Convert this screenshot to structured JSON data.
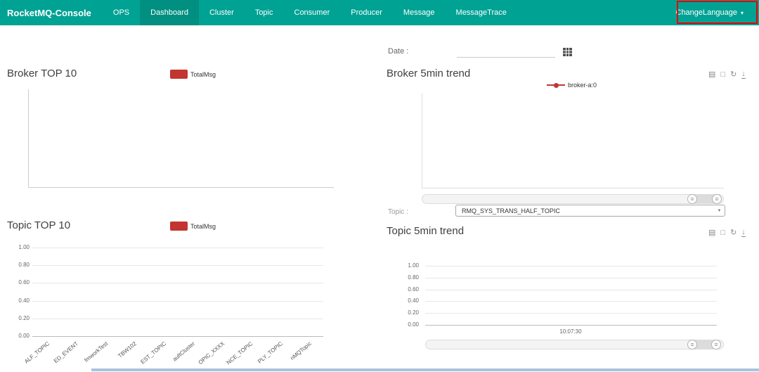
{
  "navbar": {
    "brand": "RocketMQ-Console",
    "items": [
      {
        "label": "OPS"
      },
      {
        "label": "Dashboard",
        "active": true
      },
      {
        "label": "Cluster"
      },
      {
        "label": "Topic"
      },
      {
        "label": "Consumer"
      },
      {
        "label": "Producer"
      },
      {
        "label": "Message"
      },
      {
        "label": "MessageTrace"
      }
    ],
    "change_language": "ChangeLanguage"
  },
  "filters": {
    "date_label": "Date :",
    "date_value": "",
    "topic_label": "Topic :",
    "topic_selected": "RMQ_SYS_TRANS_HALF_TOPIC"
  },
  "sections": {
    "broker_top10": {
      "title": "Broker TOP 10",
      "legend": "TotalMsg"
    },
    "broker_trend": {
      "title": "Broker 5min trend",
      "legend": "broker-a:0"
    },
    "topic_top10": {
      "title": "Topic TOP 10",
      "legend": "TotalMsg"
    },
    "topic_trend": {
      "title": "Topic 5min trend"
    }
  },
  "icons": {
    "caret_down": "▾",
    "select_arrow": "▼",
    "handle_lines": "≡",
    "toolbox": [
      "▤",
      "□",
      "↻",
      "↓"
    ]
  },
  "colors": {
    "navbar_teal": "#00A294",
    "navbar_active": "#008F80",
    "series_red": "#c23531",
    "annotation_red": "#e60000"
  },
  "chart_data": [
    {
      "type": "bar",
      "title": "Broker TOP 10",
      "legend": [
        "TotalMsg"
      ],
      "categories": [],
      "values": [],
      "grid": false
    },
    {
      "type": "line",
      "title": "Broker 5min trend",
      "series": [
        {
          "name": "broker-a:0",
          "values": []
        }
      ],
      "x": [],
      "legend_position": "top-center",
      "grid": false
    },
    {
      "type": "bar",
      "title": "Topic TOP 10",
      "legend": [
        "TotalMsg"
      ],
      "categories": [
        "ALF_TOPIC",
        "ED_EVENT",
        "fmworkTest",
        "TBW102",
        "EST_TOPIC",
        "aultCluster",
        "OPIC_XXXX",
        "NCE_TOPIC",
        "PLY_TOPIC",
        "nMQTopic"
      ],
      "values": [],
      "ylim": [
        0,
        1
      ],
      "yticks": [
        "1.00",
        "0.80",
        "0.60",
        "0.40",
        "0.20",
        "0.00"
      ],
      "grid": true
    },
    {
      "type": "line",
      "title": "Topic 5min trend",
      "series": [
        {
          "name": "",
          "values": []
        }
      ],
      "x": [
        "10:07:30"
      ],
      "ylim": [
        0,
        1
      ],
      "yticks": [
        "1.00",
        "0.80",
        "0.60",
        "0.40",
        "0.20",
        "0.00"
      ],
      "grid": true
    }
  ]
}
